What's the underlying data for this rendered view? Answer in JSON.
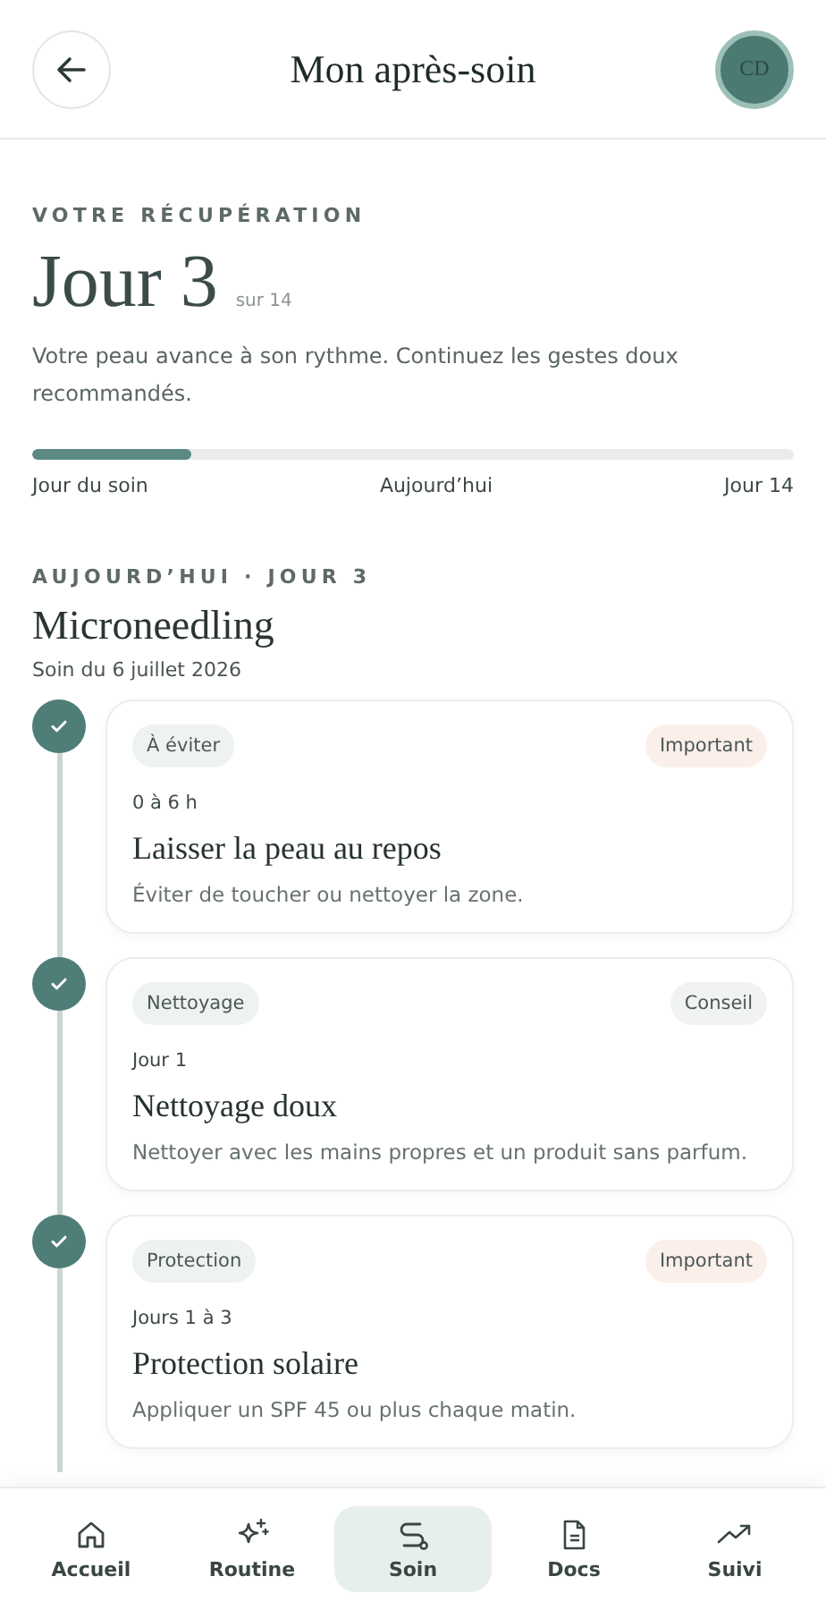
{
  "header": {
    "title": "Mon après-soin",
    "avatar": "CD"
  },
  "recovery": {
    "eyebrow": "VOTRE RÉCUPÉRATION",
    "day": "Jour 3",
    "total": "sur 14",
    "message": "Votre peau avance à son rythme. Continuez les gestes doux recommandés.",
    "level": 0.21,
    "labels": [
      "Jour du soin",
      "Aujourd’hui",
      "Jour 14"
    ]
  },
  "today": {
    "eyebrow": "AUJOURD’HUI · JOUR 3",
    "treatment": "Microneedling",
    "date": "Soin du 6 juillet 2026"
  },
  "steps": [
    {
      "done": true,
      "tag": "À éviter",
      "priority": {
        "label": "Important",
        "kind": "important"
      },
      "timing": "0 à 6 h",
      "title": "Laisser la peau au repos",
      "description": "Éviter de toucher ou nettoyer la zone."
    },
    {
      "done": true,
      "tag": "Nettoyage",
      "priority": {
        "label": "Conseil",
        "kind": "advice"
      },
      "timing": "Jour 1",
      "title": "Nettoyage doux",
      "description": "Nettoyer avec les mains propres et un produit sans parfum."
    },
    {
      "done": true,
      "tag": "Protection",
      "priority": {
        "label": "Important",
        "kind": "important"
      },
      "timing": "Jours 1 à 3",
      "title": "Protection solaire",
      "description": "Appliquer un SPF 45 ou plus chaque matin."
    }
  ],
  "nav": [
    {
      "label": "Accueil",
      "selected": false
    },
    {
      "label": "Routine",
      "selected": false
    },
    {
      "label": "Soin",
      "selected": true
    },
    {
      "label": "Docs",
      "selected": false
    },
    {
      "label": "Suivi",
      "selected": false
    }
  ]
}
